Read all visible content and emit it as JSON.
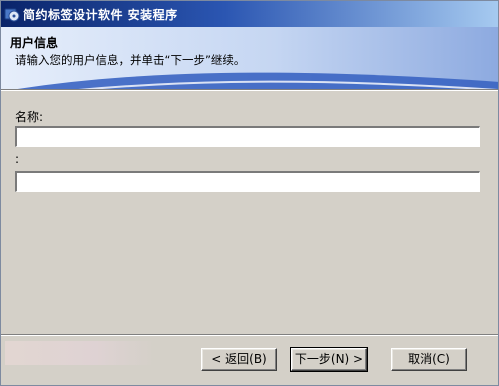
{
  "window": {
    "title": "简约标签设计软件  安装程序"
  },
  "header": {
    "title": "用户信息",
    "subtitle": "请输入您的用户信息，并单击“下一步”继续。"
  },
  "form": {
    "name_label": "名称:",
    "name_value": "",
    "second_label": ":",
    "second_value": ""
  },
  "buttons": {
    "back": "< 返回(B)",
    "next": "下一步(N) >",
    "cancel": "取消(C)"
  }
}
